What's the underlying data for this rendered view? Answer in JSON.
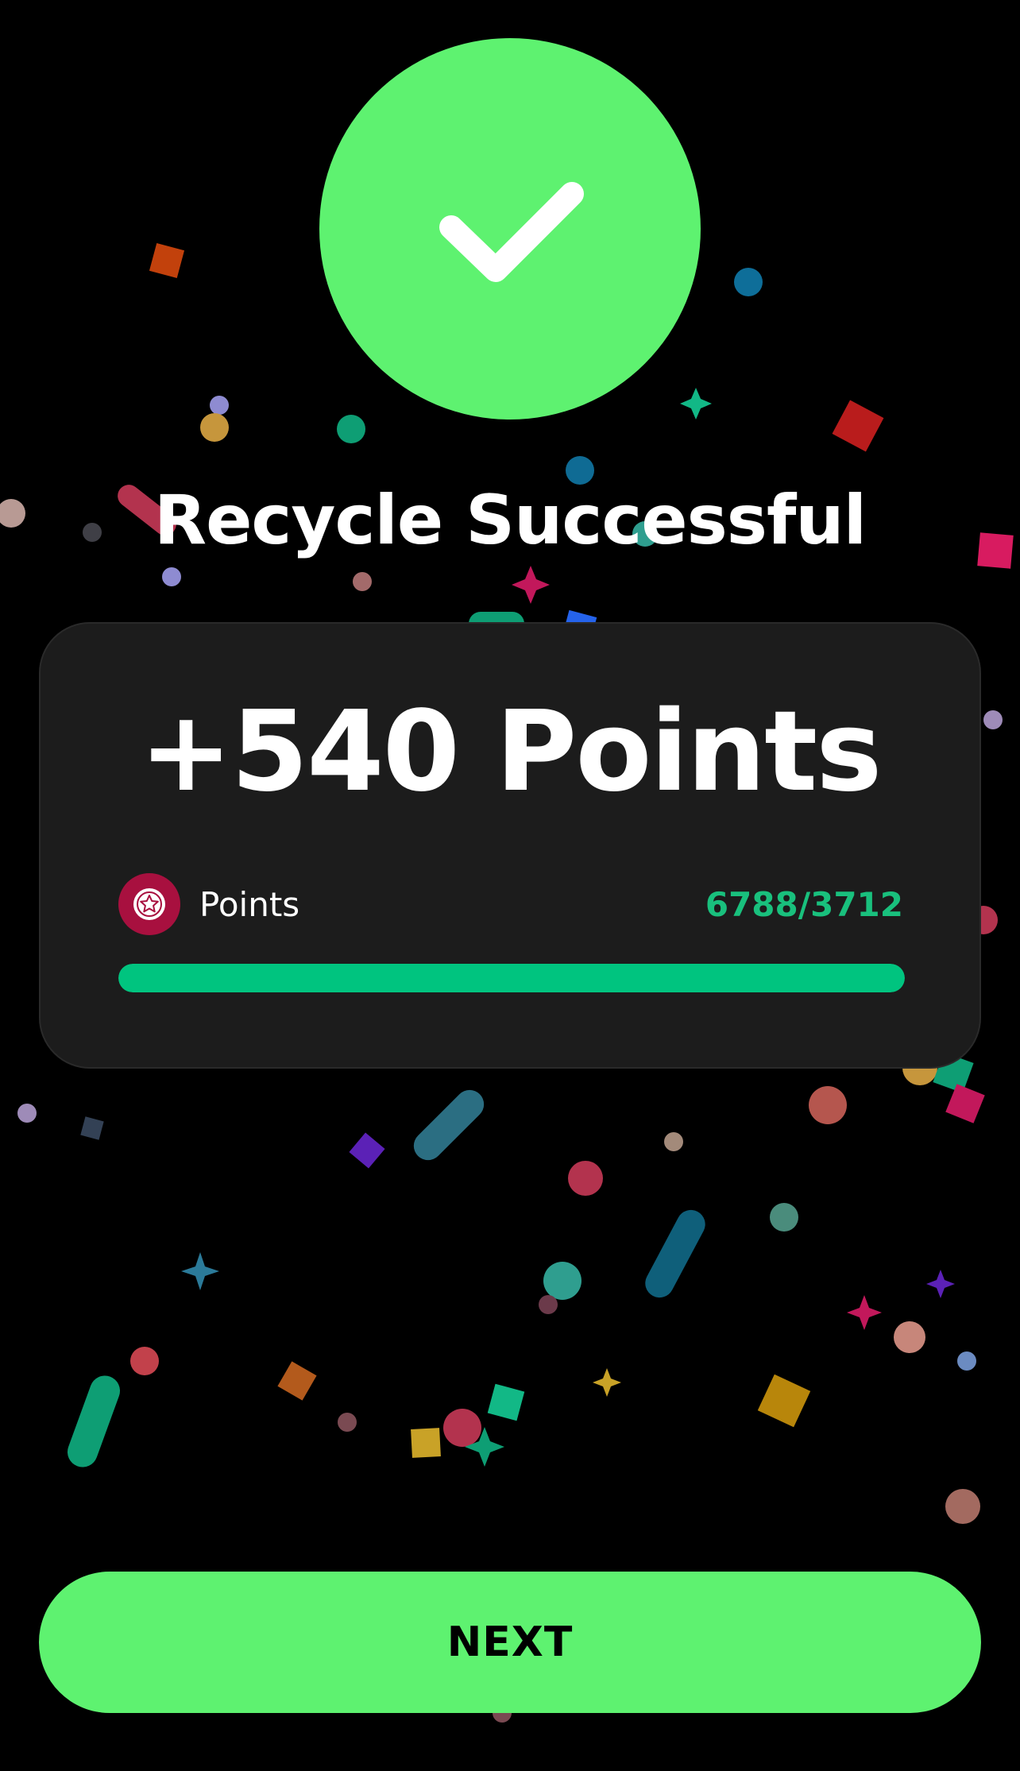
{
  "title": "Recycle Successful",
  "card": {
    "points_awarded": "+540 Points",
    "label": "Points",
    "progress_text": "6788/3712",
    "progress_fraction": 1.0
  },
  "next_button": {
    "label": "NEXT"
  },
  "icons": {
    "success": "checkmark-icon",
    "points_badge": "star-badge-icon"
  },
  "colors": {
    "accent_green": "#5EF270",
    "progress_green": "#00C47F",
    "badge_red": "#A8103F",
    "card_bg": "#1C1C1C"
  }
}
